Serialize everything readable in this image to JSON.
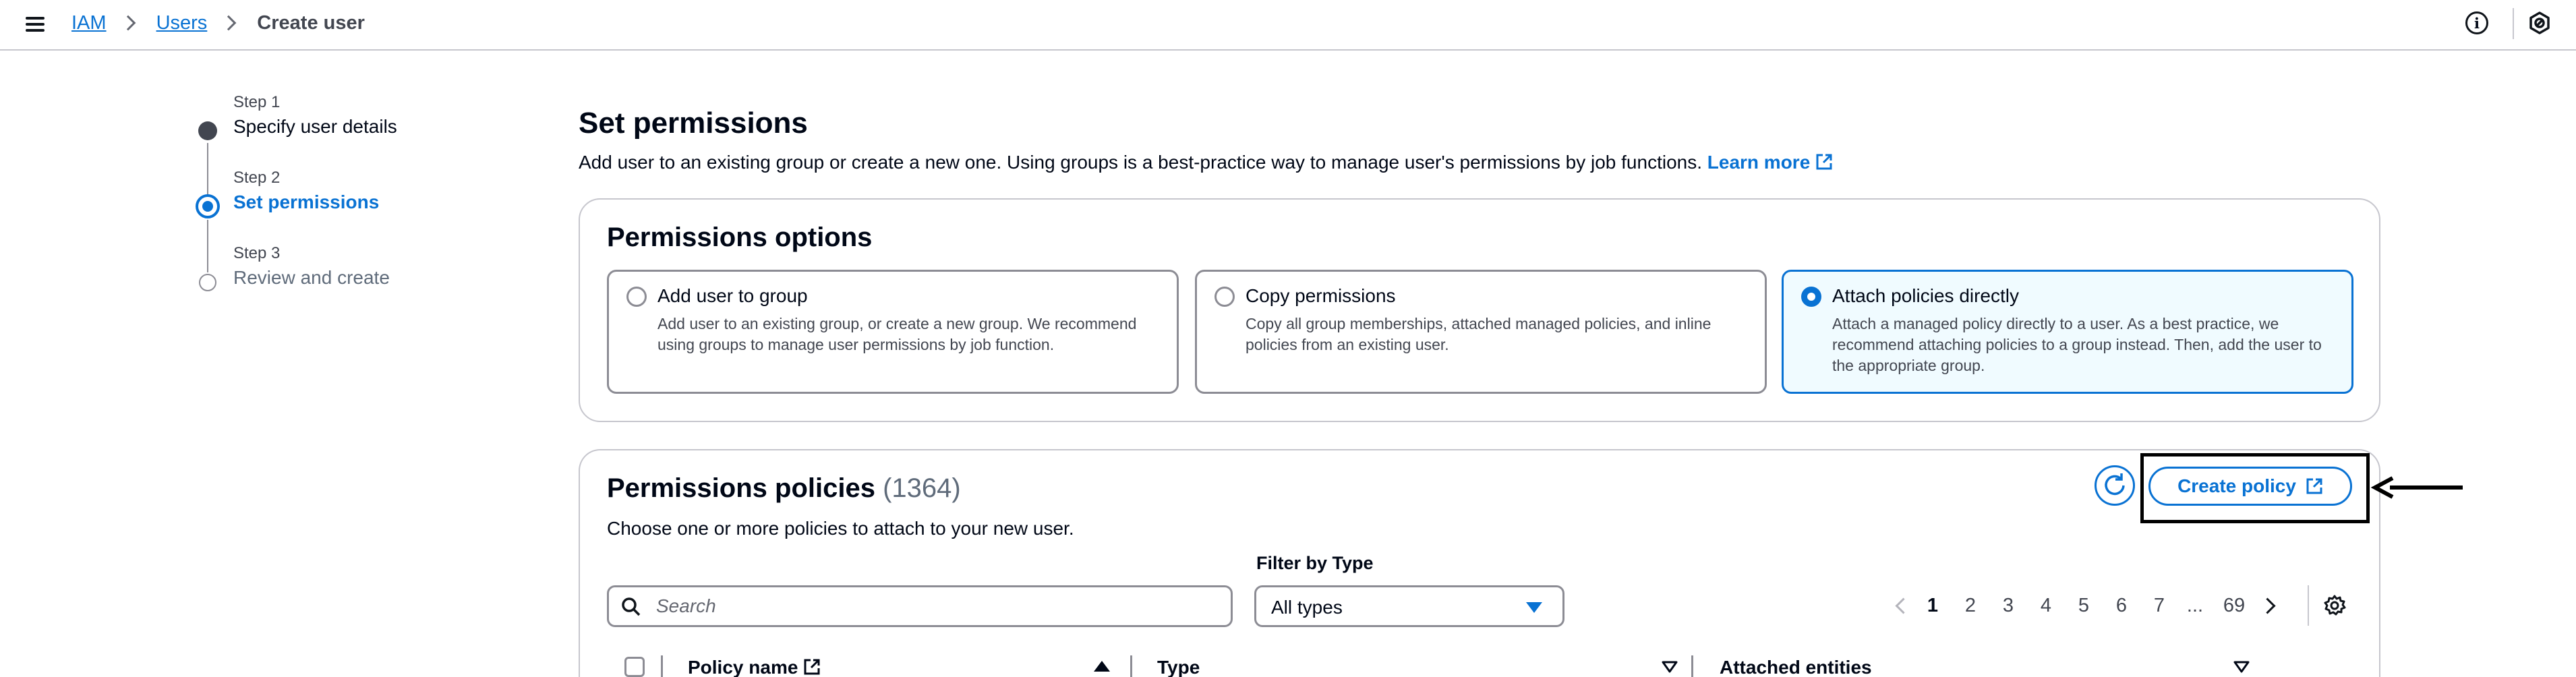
{
  "breadcrumb": {
    "items": [
      "IAM",
      "Users"
    ],
    "current": "Create user"
  },
  "topbar": {
    "menu_icon": "hamburger-menu-icon",
    "info_icon": "info-icon",
    "settings_icon": "settings-icon",
    "info_glyph": "i"
  },
  "stepper": {
    "steps": [
      {
        "num": "Step 1",
        "title": "Specify user details",
        "state": "complete"
      },
      {
        "num": "Step 2",
        "title": "Set permissions",
        "state": "active"
      },
      {
        "num": "Step 3",
        "title": "Review and create",
        "state": "pending"
      }
    ]
  },
  "page": {
    "title": "Set permissions",
    "description": "Add user to an existing group or create a new one. Using groups is a best-practice way to manage user's permissions by job functions.",
    "learn_more": "Learn more"
  },
  "options": {
    "heading": "Permissions options",
    "tiles": [
      {
        "title": "Add user to group",
        "desc": "Add user to an existing group, or create a new group. We recommend using groups to manage user permissions by job function.",
        "selected": false
      },
      {
        "title": "Copy permissions",
        "desc": "Copy all group memberships, attached managed policies, and inline policies from an existing user.",
        "selected": false
      },
      {
        "title": "Attach policies directly",
        "desc": "Attach a managed policy directly to a user. As a best practice, we recommend attaching policies to a group instead. Then, add the user to the appropriate group.",
        "selected": true
      }
    ]
  },
  "policies": {
    "heading": "Permissions policies",
    "count": "(1364)",
    "description": "Choose one or more policies to attach to your new user.",
    "create_policy": "Create policy",
    "filter_label": "Filter by Type",
    "search_placeholder": "Search",
    "type_selected": "All types",
    "pagination": {
      "pages": [
        "1",
        "2",
        "3",
        "4",
        "5",
        "6",
        "7"
      ],
      "ellipsis": "...",
      "last": "69",
      "current": "1"
    },
    "columns": [
      "Policy name",
      "Type",
      "Attached entities"
    ]
  },
  "colors": {
    "accent": "#0972d3",
    "selected_tile_bg": "#f0fbff",
    "border": "#8c8c94"
  }
}
